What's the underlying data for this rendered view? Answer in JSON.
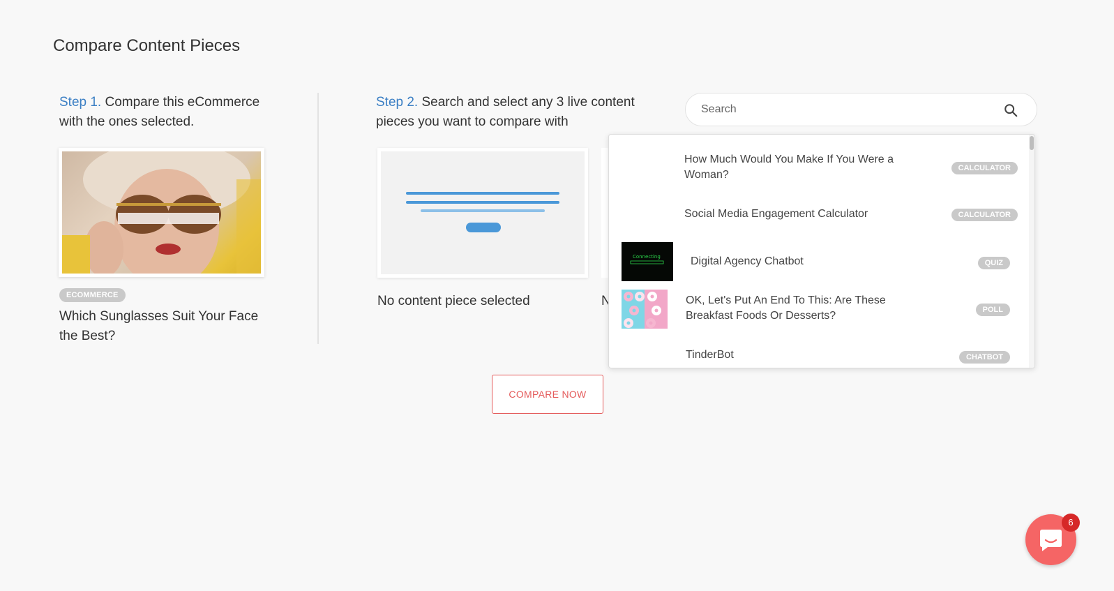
{
  "page": {
    "title": "Compare Content Pieces"
  },
  "step1": {
    "label": "Step 1.",
    "text": " Compare this eCommerce with the ones selected.",
    "content_type_badge": "ECOMMERCE",
    "content_title": "Which Sunglasses Suit Your Face the Best?"
  },
  "step2": {
    "label": "Step 2.",
    "text": " Search and select any 3 live content pieces you want to compare with",
    "slots": [
      {
        "empty_text": "No content piece selected"
      },
      {
        "empty_text": "No content piece selected"
      }
    ]
  },
  "search": {
    "placeholder": "Search",
    "icon": "search-icon"
  },
  "results": [
    {
      "title": "How Much Would You Make If You Were a Woman?",
      "badge": "CALCULATOR",
      "thumbnail": "none"
    },
    {
      "title": "Social Media Engagement Calculator",
      "badge": "CALCULATOR",
      "thumbnail": "none"
    },
    {
      "title": "Digital Agency Chatbot",
      "badge": "QUIZ",
      "thumbnail": "chatbot-connecting-screen",
      "thumb_text": "Connecting"
    },
    {
      "title": "OK, Let's Put An End To This: Are These Breakfast Foods Or Desserts?",
      "badge": "POLL",
      "thumbnail": "donuts-pink-blue"
    },
    {
      "title": "TinderBot",
      "badge": "CHATBOT",
      "thumbnail": "none"
    }
  ],
  "actions": {
    "compare_label": "COMPARE NOW"
  },
  "chat": {
    "unread_count": "6",
    "icon": "chat-bubble-icon"
  },
  "colors": {
    "accent_blue": "#3b7fc4",
    "compare_red": "#e45a5a",
    "chat_red": "#f56565",
    "badge_gray": "#c9c9c9"
  }
}
